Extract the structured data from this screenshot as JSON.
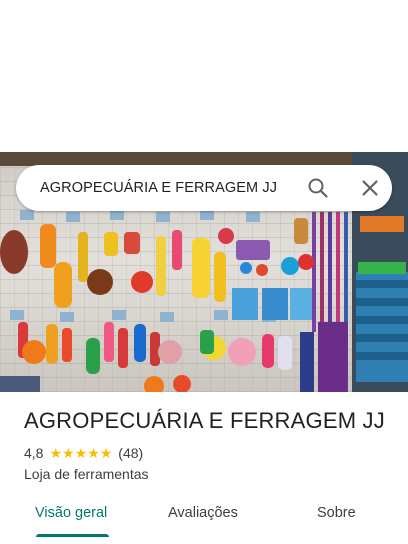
{
  "search": {
    "query": "AGROPECUÁRIA E FERRAGEM JJ",
    "search_icon": "search-icon",
    "close_icon": "close-icon"
  },
  "place": {
    "name": "AGROPECUÁRIA E FERRAGEM JJ",
    "rating": "4,8",
    "stars": 5,
    "review_count": "(48)",
    "category": "Loja de ferramentas"
  },
  "tabs": [
    {
      "label": "Visão geral",
      "active": true
    },
    {
      "label": "Avaliações",
      "active": false
    },
    {
      "label": "Sobre",
      "active": false
    }
  ],
  "colors": {
    "accent": "#00796b",
    "star": "#fbbc04"
  }
}
